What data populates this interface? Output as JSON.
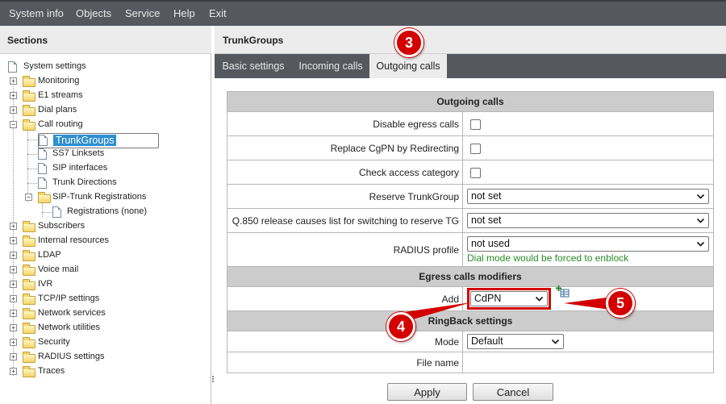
{
  "menu": [
    "System info",
    "Objects",
    "Service",
    "Help",
    "Exit"
  ],
  "sections": {
    "title": "Sections",
    "tree": [
      {
        "label": "System settings"
      },
      {
        "label": "Monitoring"
      },
      {
        "label": "E1 streams"
      },
      {
        "label": "Dial plans"
      },
      {
        "label": "Call routing"
      },
      {
        "label": "TrunkGroups",
        "selected": true
      },
      {
        "label": "SS7 Linksets"
      },
      {
        "label": "SIP interfaces"
      },
      {
        "label": "Trunk Directions"
      },
      {
        "label": "SIP-Trunk Registrations"
      },
      {
        "label": "Registrations (none)"
      },
      {
        "label": "Subscribers"
      },
      {
        "label": "Internal resources"
      },
      {
        "label": "LDAP"
      },
      {
        "label": "Voice mail"
      },
      {
        "label": "IVR"
      },
      {
        "label": "TCP/IP settings"
      },
      {
        "label": "Network services"
      },
      {
        "label": "Network utilities"
      },
      {
        "label": "Security"
      },
      {
        "label": "RADIUS settings"
      },
      {
        "label": "Traces"
      }
    ]
  },
  "page_title": "TrunkGroups",
  "tabs": [
    {
      "label": "Basic settings"
    },
    {
      "label": "Incoming calls"
    },
    {
      "label": "Outgoing calls",
      "active": true
    }
  ],
  "form": {
    "outgoing_header": "Outgoing calls",
    "disable_egress": {
      "label": "Disable egress calls",
      "checked": false
    },
    "replace_cgpn": {
      "label": "Replace CgPN by Redirecting",
      "checked": false
    },
    "check_access": {
      "label": "Check access category",
      "checked": false
    },
    "reserve_trunkgroup": {
      "label": "Reserve TrunkGroup",
      "value": "not set"
    },
    "q850": {
      "label": "Q.850 release causes list for switching to reserve TG",
      "value": "not set"
    },
    "radius_profile": {
      "label": "RADIUS profile",
      "value": "not used",
      "hint": "Dial mode would be forced to enblock"
    },
    "modifiers_header": "Egress calls modifiers",
    "add": {
      "label": "Add",
      "value": "CdPN"
    },
    "ringback_header": "RingBack settings",
    "mode": {
      "label": "Mode",
      "value": "Default"
    },
    "file_name": {
      "label": "File name",
      "value": ""
    }
  },
  "buttons": {
    "apply": "Apply",
    "cancel": "Cancel"
  },
  "callouts": [
    "3",
    "4",
    "5"
  ],
  "colors": {
    "menubar": "#55595d",
    "selected": "#2d8fcf",
    "section_header": "#cccccc",
    "hint": "#2a8a2a",
    "callout": "#d40000"
  }
}
